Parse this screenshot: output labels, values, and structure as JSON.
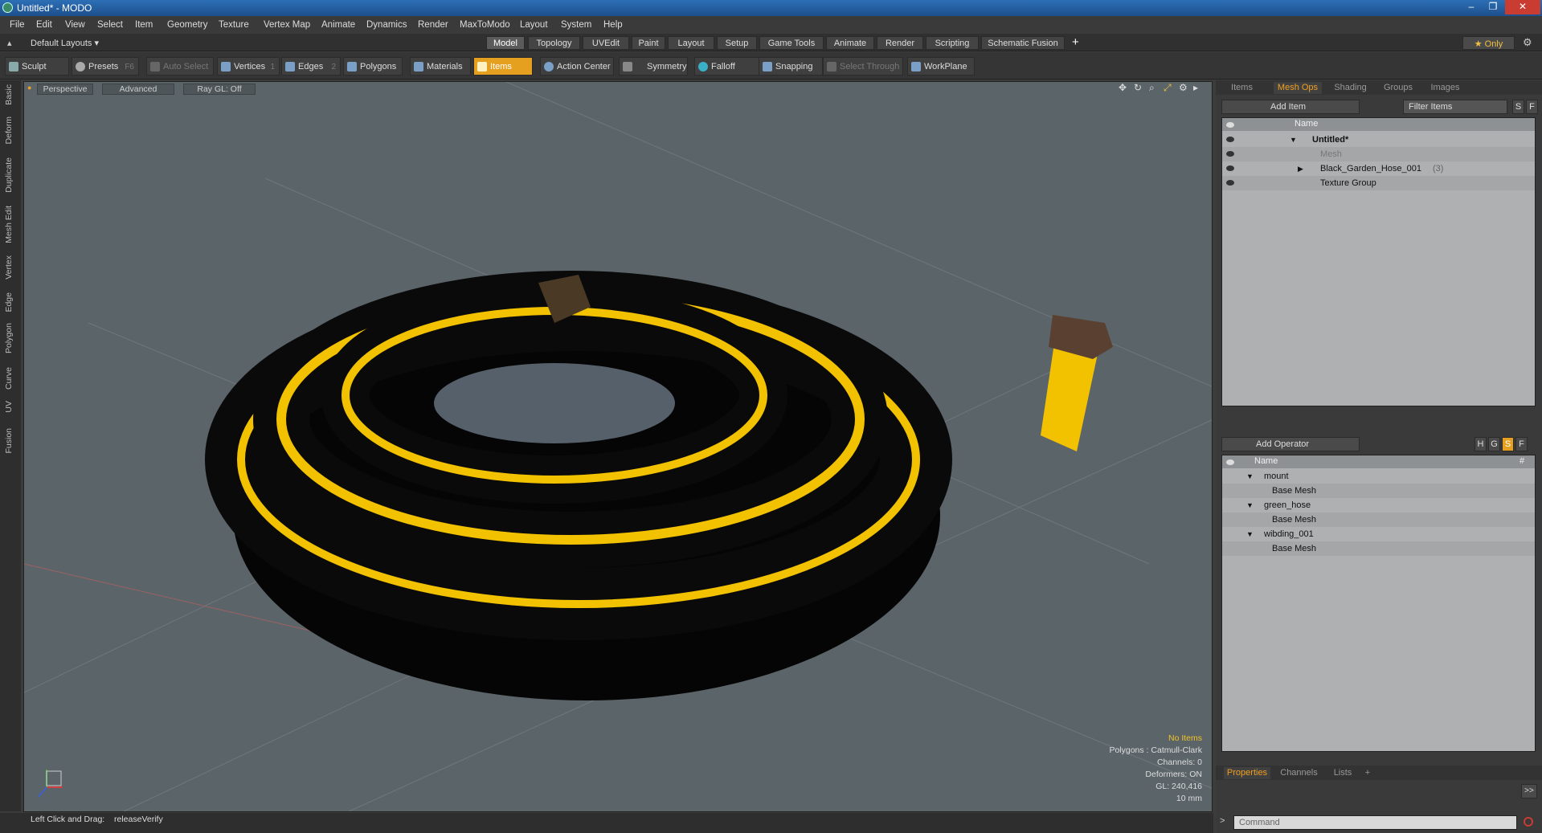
{
  "window": {
    "title": "Untitled* - MODO",
    "minimize": "–",
    "maximize": "❐",
    "close": "✕"
  },
  "menu": [
    "File",
    "Edit",
    "View",
    "Select",
    "Item",
    "Geometry",
    "Texture",
    "Vertex Map",
    "Animate",
    "Dynamics",
    "Render",
    "MaxToModo",
    "Layout",
    "System",
    "Help"
  ],
  "layouts": {
    "dropdown_label": "Default Layouts ▾",
    "tabs": [
      "Model",
      "Topology",
      "UVEdit",
      "Paint",
      "Layout",
      "Setup",
      "Game Tools",
      "Animate",
      "Render",
      "Scripting",
      "Schematic Fusion"
    ],
    "active_tab": "Model",
    "add": "+",
    "only_label": "★ Only"
  },
  "toolbar": {
    "sculpt": "Sculpt",
    "presets": "Presets",
    "presets_key": "F6",
    "auto_select": "Auto Select",
    "vertices": "Vertices",
    "vertices_key": "1",
    "edges": "Edges",
    "edges_key": "2",
    "polygons": "Polygons",
    "materials": "Materials",
    "items": "Items",
    "action_center": "Action Center",
    "symmetry": "Symmetry",
    "falloff": "Falloff",
    "snapping": "Snapping",
    "select_through": "Select Through",
    "workplane": "WorkPlane"
  },
  "left_tabs": [
    "Basic",
    "Deform",
    "Duplicate",
    "Mesh Edit",
    "Vertex",
    "Edge",
    "Polygon",
    "Curve",
    "UV",
    "Fusion"
  ],
  "viewport": {
    "view_mode": "Perspective",
    "shading": "Advanced",
    "raygl": "Ray GL: Off",
    "hud": {
      "no_items": "No Items",
      "polygons": "Polygons : Catmull-Clark",
      "channels": "Channels: 0",
      "deformers": "Deformers: ON",
      "gl": "GL: 240,416",
      "scale": "10 mm"
    }
  },
  "item_panel": {
    "tabs": [
      "Items",
      "Mesh Ops",
      "Shading",
      "Groups",
      "Images"
    ],
    "active_tab": "Mesh Ops",
    "add_item": "Add Item",
    "filter": "Filter Items",
    "btn_s": "S",
    "btn_f": "F",
    "col_name": "Name",
    "rows": [
      {
        "label": "Untitled*",
        "kind": "scene"
      },
      {
        "label": "Mesh",
        "kind": "mesh-dim"
      },
      {
        "label": "Black_Garden_Hose_001",
        "count": "(3)",
        "kind": "group"
      },
      {
        "label": "Texture Group",
        "kind": "group"
      }
    ]
  },
  "operator_panel": {
    "add_operator": "Add Operator",
    "col_name": "Name",
    "col_hash": "#",
    "buttons": [
      "H",
      "G",
      "S",
      "F"
    ],
    "rows": [
      {
        "label": "mount",
        "level": 0
      },
      {
        "label": "Base Mesh",
        "level": 1
      },
      {
        "label": "green_hose",
        "level": 0
      },
      {
        "label": "Base Mesh",
        "level": 1
      },
      {
        "label": "wibding_001",
        "level": 0
      },
      {
        "label": "Base Mesh",
        "level": 1
      }
    ]
  },
  "bottom_panel": {
    "tabs": [
      "Properties",
      "Channels",
      "Lists"
    ],
    "active_tab": "Properties",
    "add": "+",
    "expand": ">>"
  },
  "status": {
    "hint": "Left Click and Drag:",
    "action": "releaseVerify"
  },
  "command": {
    "placeholder": "Command",
    "prompt": ">"
  },
  "colors": {
    "accent": "#f0a020",
    "hose_yellow": "#f2c200",
    "viewport_bg": "#5b6469"
  }
}
